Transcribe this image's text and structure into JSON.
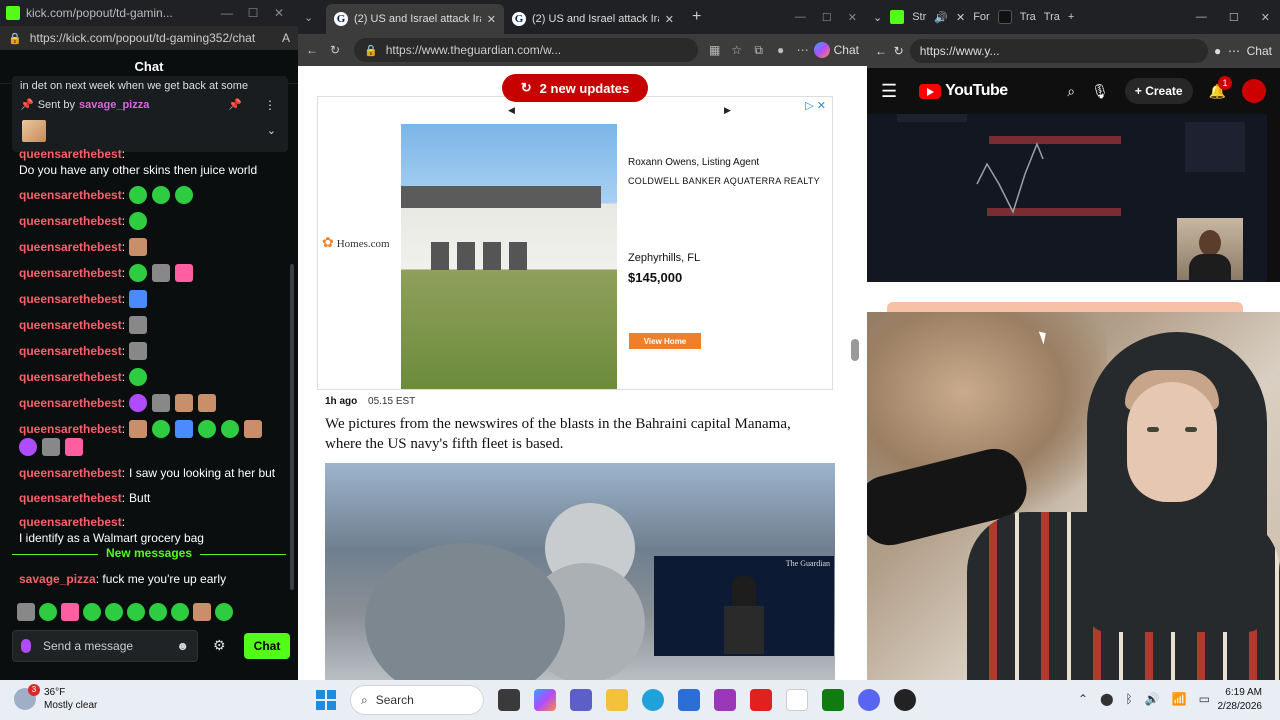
{
  "kick": {
    "window_title": "kick.com/popout/td-gamin...",
    "url": "https://kick.com/popout/td-gaming352/chat",
    "header": "Chat",
    "pinned": {
      "partial_text": "in det on next week when we get back at some",
      "sent_by_label": "Sent by",
      "sent_by_user": "savage_pizza"
    },
    "messages": [
      {
        "user": "queensarethebest",
        "text": "Do you have any other skins then juice world",
        "emotes": []
      },
      {
        "user": "queensarethebest",
        "text": "",
        "emotes": [
          "e-green",
          "e-green",
          "e-green"
        ]
      },
      {
        "user": "queensarethebest",
        "text": "",
        "emotes": [
          "e-green"
        ]
      },
      {
        "user": "queensarethebest",
        "text": "",
        "emotes": [
          "e-face"
        ]
      },
      {
        "user": "queensarethebest",
        "text": "",
        "emotes": [
          "e-green",
          "e-gray",
          "e-pink"
        ]
      },
      {
        "user": "queensarethebest",
        "text": "",
        "emotes": [
          "e-blue"
        ]
      },
      {
        "user": "queensarethebest",
        "text": "",
        "emotes": [
          "e-gray"
        ]
      },
      {
        "user": "queensarethebest",
        "text": "",
        "emotes": [
          "e-gray"
        ]
      },
      {
        "user": "queensarethebest",
        "text": "",
        "emotes": [
          "e-green"
        ]
      },
      {
        "user": "queensarethebest",
        "text": "",
        "emotes": [
          "e-purple",
          "e-gray",
          "e-face",
          "e-face"
        ]
      },
      {
        "user": "queensarethebest",
        "text": "",
        "emotes": [
          "e-face",
          "e-green",
          "e-blue",
          "e-green",
          "e-green",
          "e-face",
          "e-purple",
          "e-gray",
          "e-pink"
        ]
      },
      {
        "user": "queensarethebest",
        "text": "I saw you looking at her but",
        "emotes": []
      },
      {
        "user": "queensarethebest",
        "text": "Butt",
        "emotes": []
      },
      {
        "user": "queensarethebest",
        "text": "I identify as a Walmart grocery bag",
        "emotes": []
      }
    ],
    "new_messages_label": "New messages",
    "last_message": {
      "user": "savage_pizza",
      "text": "fuck me you're up early"
    },
    "send_placeholder": "Send a message",
    "chat_button": "Chat",
    "colors": {
      "accent": "#53fc18",
      "username": "#ff5f6b",
      "sent_by": "#e062e0"
    }
  },
  "guardian": {
    "tabs": [
      {
        "label": "(2) US and Israel attack Iran as"
      },
      {
        "label": "(2) US and Israel attack Iran as"
      }
    ],
    "url": "https://www.theguardian.com/w...",
    "copilot_label": "Chat",
    "updates_button": "2 new updates",
    "ad": {
      "brand": "Homes.com",
      "agent_name": "Roxann Owens, Listing Agent",
      "agency": "COLDWELL BANKER AQUATERRA REALTY",
      "location": "Zephyrhills, FL",
      "price": "$145,000",
      "cta": "View Home"
    },
    "post": {
      "age": "1h ago",
      "time": "05.15 EST",
      "text": "We pictures from the newswires of the blasts in the Bahraini capital Manama, where the US navy's fifth fleet is based."
    },
    "inset_logo": "The Guardian",
    "colors": {
      "brand_red": "#c70000"
    }
  },
  "youtube": {
    "tab_labels": [
      "Str",
      "For",
      "Tra",
      "Tra"
    ],
    "url": "https://www.y...",
    "copilot_label": "Chat",
    "logo_text": "YouTube",
    "create_label": "Create",
    "notification_count": "1"
  },
  "taskbar": {
    "weather_temp": "36°F",
    "weather_desc": "Mostly clear",
    "weather_badge": "3",
    "search_placeholder": "Search",
    "time": "6:19 AM",
    "date": "2/28/2026"
  }
}
